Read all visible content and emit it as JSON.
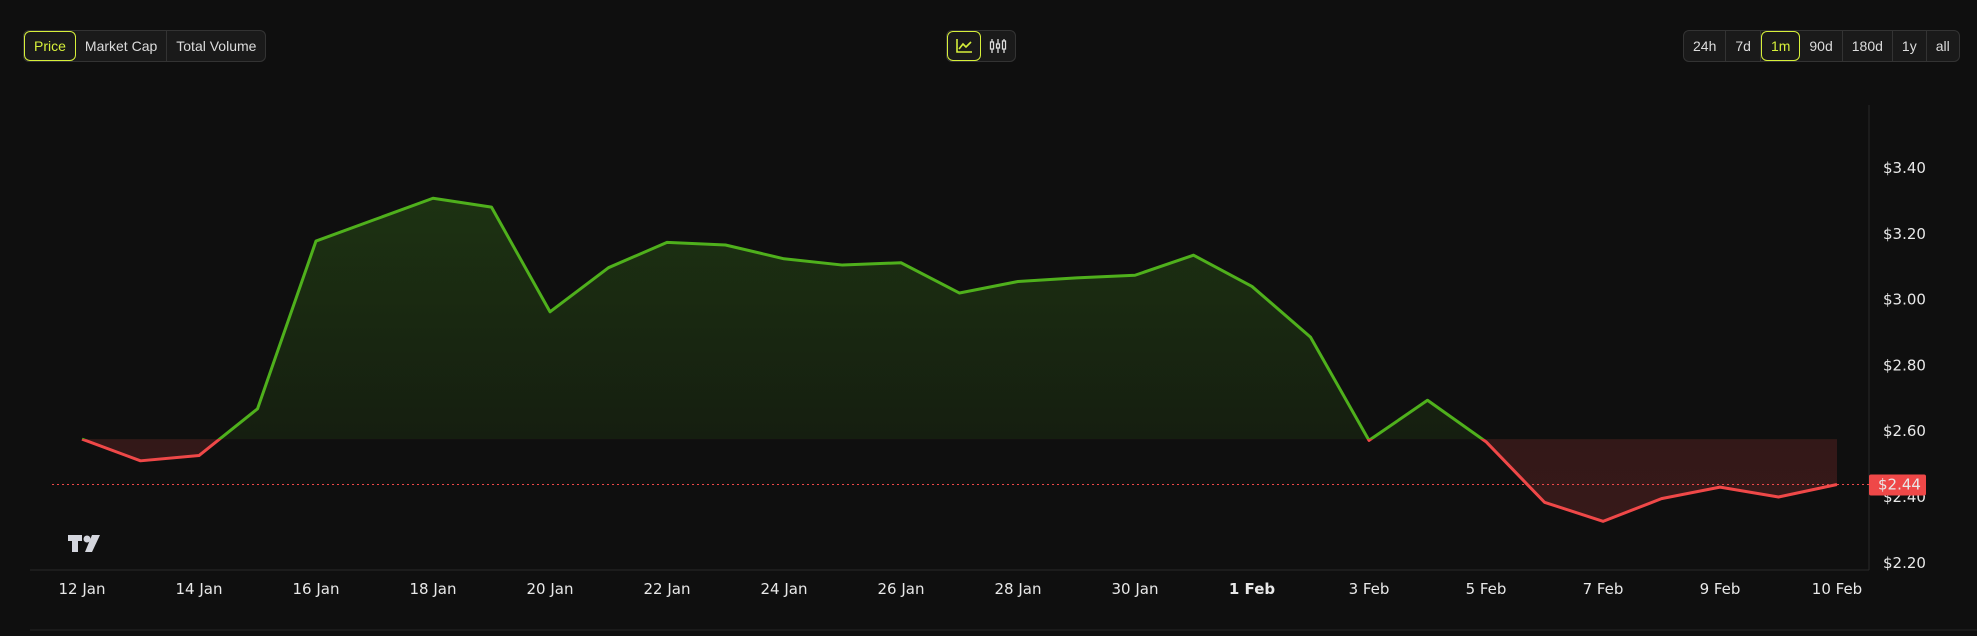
{
  "metric_tabs": [
    {
      "label": "Price",
      "active": true
    },
    {
      "label": "Market Cap",
      "active": false
    },
    {
      "label": "Total Volume",
      "active": false
    }
  ],
  "chart_type_toggle": [
    {
      "icon": "line-chart-icon",
      "active": true
    },
    {
      "icon": "candlestick-icon",
      "active": false
    }
  ],
  "range_tabs": [
    {
      "label": "24h",
      "active": false
    },
    {
      "label": "7d",
      "active": false
    },
    {
      "label": "1m",
      "active": true
    },
    {
      "label": "90d",
      "active": false
    },
    {
      "label": "180d",
      "active": false
    },
    {
      "label": "1y",
      "active": false
    },
    {
      "label": "all",
      "active": false
    }
  ],
  "colors": {
    "up": "#4fb01c",
    "down": "#ef4848",
    "accent": "#d7f03a",
    "background": "#0f0f0f"
  },
  "chart_data": {
    "type": "area",
    "baseline": 2.576,
    "current_price_label": "$2.44",
    "current_price": 2.438,
    "ylim": [
      2.18,
      3.61
    ],
    "y_ticks": [
      {
        "value": 3.4,
        "label": "$3.40"
      },
      {
        "value": 3.2,
        "label": "$3.20"
      },
      {
        "value": 3.0,
        "label": "$3.00"
      },
      {
        "value": 2.8,
        "label": "$2.80"
      },
      {
        "value": 2.6,
        "label": "$2.60"
      },
      {
        "value": 2.4,
        "label": "$2.40"
      },
      {
        "value": 2.2,
        "label": "$2.20"
      }
    ],
    "x_ticks": [
      {
        "index": 0,
        "label": "12 Jan",
        "bold": false
      },
      {
        "index": 2,
        "label": "14 Jan",
        "bold": false
      },
      {
        "index": 4,
        "label": "16 Jan",
        "bold": false
      },
      {
        "index": 6,
        "label": "18 Jan",
        "bold": false
      },
      {
        "index": 8,
        "label": "20 Jan",
        "bold": false
      },
      {
        "index": 10,
        "label": "22 Jan",
        "bold": false
      },
      {
        "index": 12,
        "label": "24 Jan",
        "bold": false
      },
      {
        "index": 14,
        "label": "26 Jan",
        "bold": false
      },
      {
        "index": 16,
        "label": "28 Jan",
        "bold": false
      },
      {
        "index": 18,
        "label": "30 Jan",
        "bold": false
      },
      {
        "index": 20,
        "label": "1 Feb",
        "bold": true
      },
      {
        "index": 22,
        "label": "3 Feb",
        "bold": false
      },
      {
        "index": 24,
        "label": "5 Feb",
        "bold": false
      },
      {
        "index": 26,
        "label": "7 Feb",
        "bold": false
      },
      {
        "index": 28,
        "label": "9 Feb",
        "bold": false
      },
      {
        "index": 30,
        "label": "10 Feb",
        "bold": false
      }
    ],
    "values": [
      2.576,
      2.51,
      2.526,
      2.668,
      3.178,
      3.243,
      3.308,
      3.281,
      2.963,
      3.097,
      3.174,
      3.166,
      3.124,
      3.105,
      3.112,
      3.02,
      3.055,
      3.066,
      3.074,
      3.135,
      3.04,
      2.886,
      2.572,
      2.694,
      2.568,
      2.384,
      2.326,
      2.395,
      2.43,
      2.4,
      2.438
    ]
  }
}
